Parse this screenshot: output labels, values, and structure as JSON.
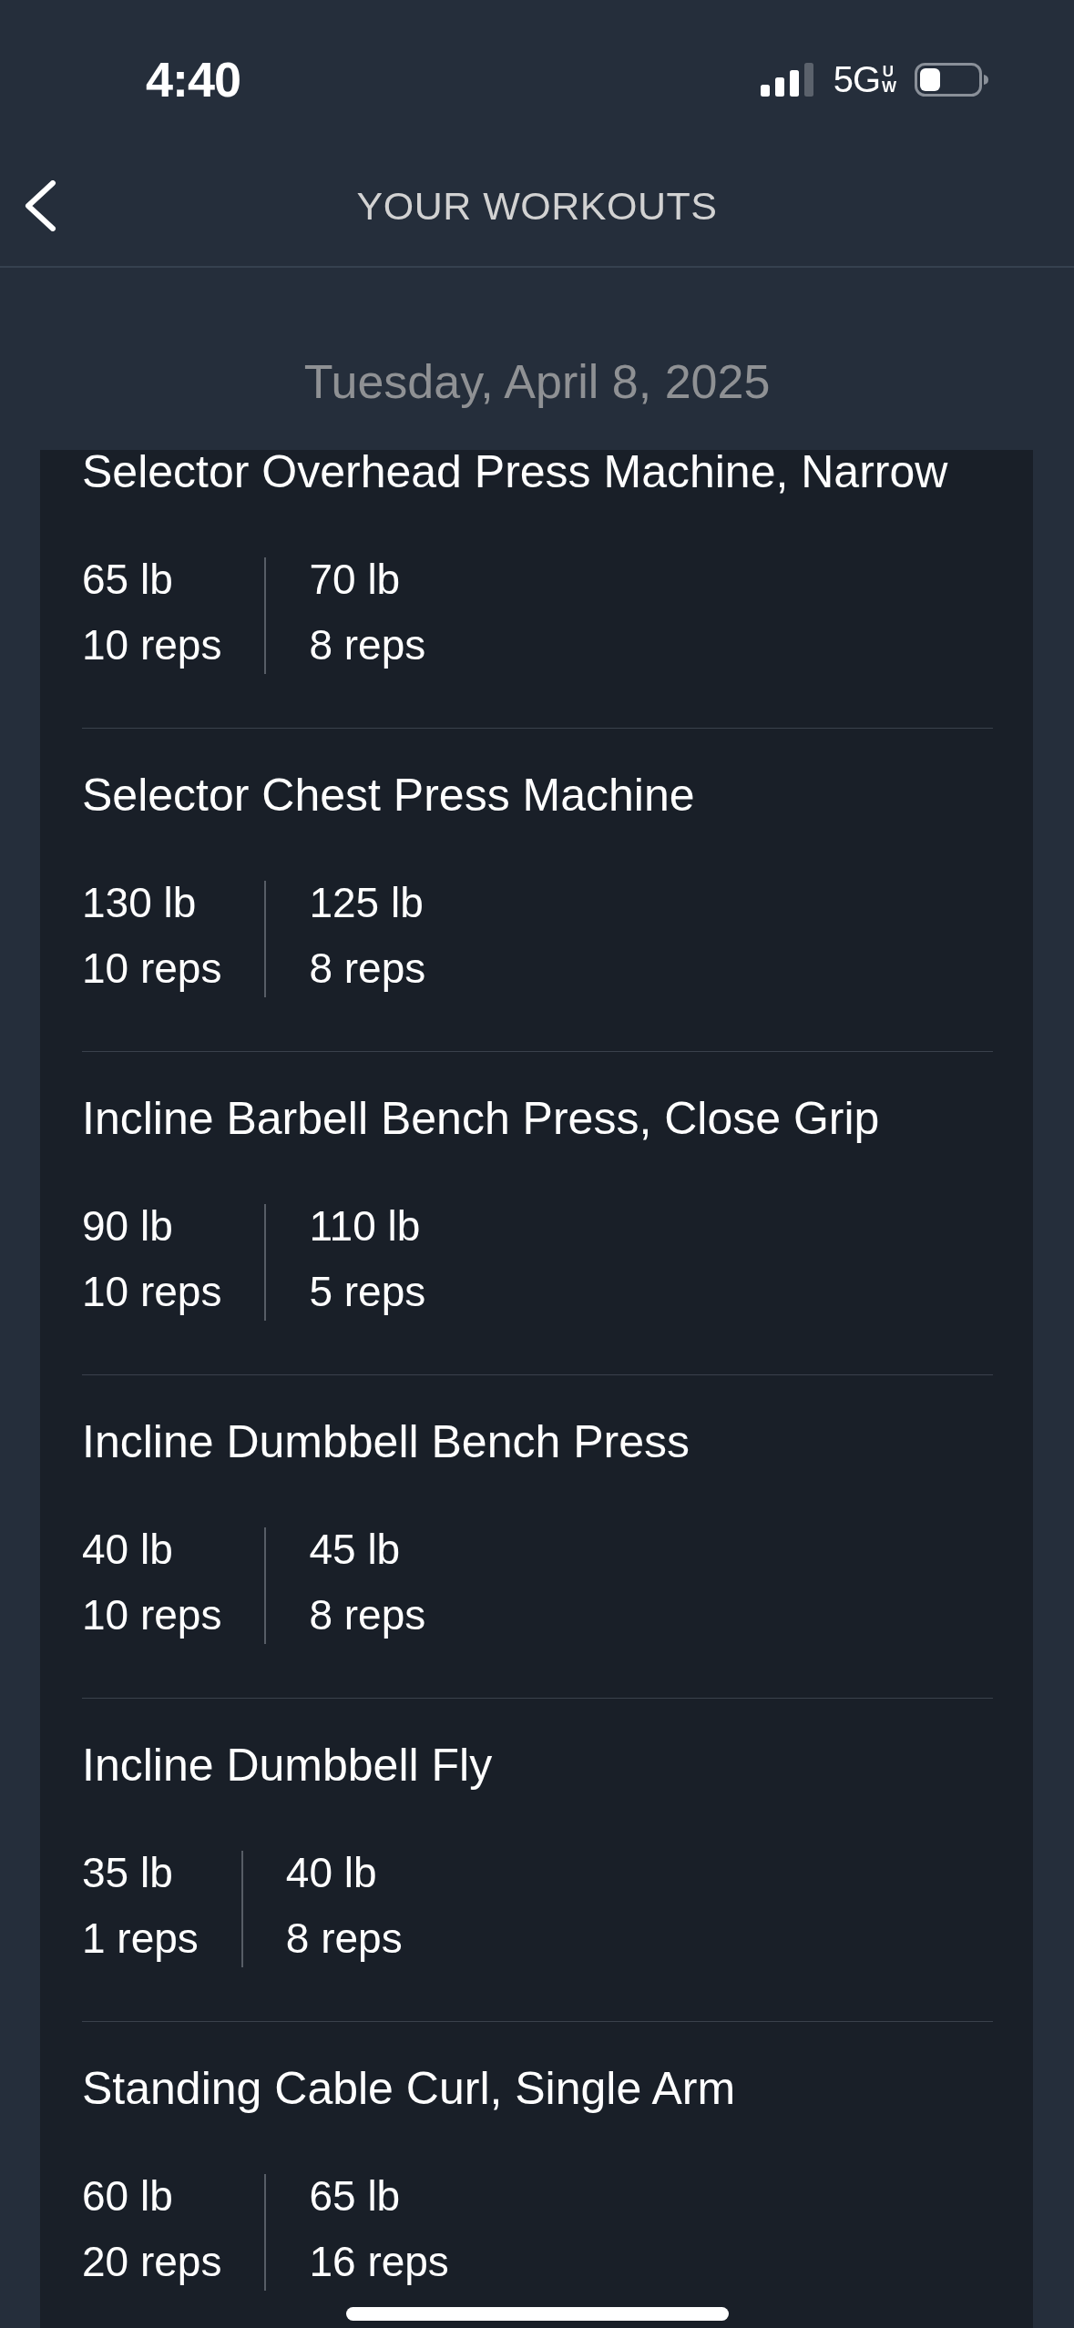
{
  "status_bar": {
    "time": "4:40",
    "network": "5G",
    "network_suffix": "UW"
  },
  "header": {
    "title": "YOUR WORKOUTS"
  },
  "date": "Tuesday, April 8, 2025",
  "exercises": [
    {
      "name": "Selector Overhead Press Machine, Narrow",
      "sets": [
        {
          "weight": "65 lb",
          "reps": "10 reps"
        },
        {
          "weight": "70 lb",
          "reps": "8 reps"
        }
      ]
    },
    {
      "name": "Selector Chest Press Machine",
      "sets": [
        {
          "weight": "130 lb",
          "reps": "10 reps"
        },
        {
          "weight": "125 lb",
          "reps": "8 reps"
        }
      ]
    },
    {
      "name": "Incline Barbell Bench Press, Close Grip",
      "sets": [
        {
          "weight": "90 lb",
          "reps": "10 reps"
        },
        {
          "weight": "110 lb",
          "reps": "5 reps"
        }
      ]
    },
    {
      "name": "Incline Dumbbell Bench Press",
      "sets": [
        {
          "weight": "40 lb",
          "reps": "10 reps"
        },
        {
          "weight": "45 lb",
          "reps": "8 reps"
        }
      ]
    },
    {
      "name": "Incline Dumbbell Fly",
      "sets": [
        {
          "weight": "35 lb",
          "reps": "1 reps"
        },
        {
          "weight": "40 lb",
          "reps": "8 reps"
        }
      ]
    },
    {
      "name": "Standing Cable Curl, Single Arm",
      "sets": [
        {
          "weight": "60 lb",
          "reps": "20 reps"
        },
        {
          "weight": "65 lb",
          "reps": "16 reps"
        }
      ]
    }
  ]
}
